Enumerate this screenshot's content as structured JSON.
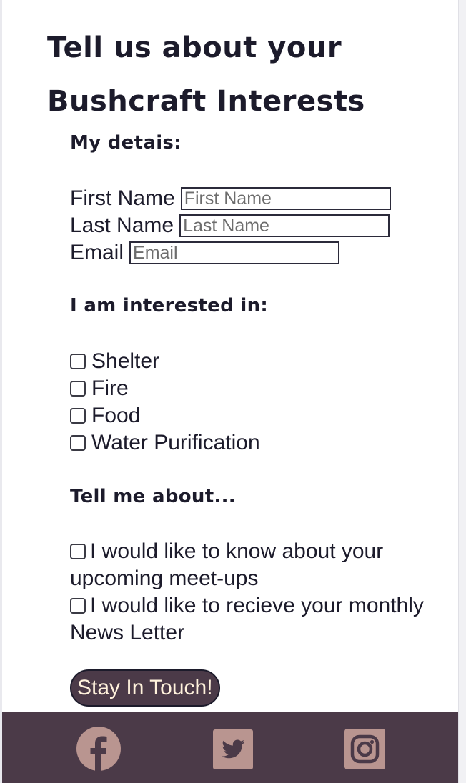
{
  "title": "Tell us about your Bushcraft Interests",
  "details": {
    "heading": "My detais:",
    "first_name": {
      "label": "First Name",
      "placeholder": "First Name",
      "value": ""
    },
    "last_name": {
      "label": "Last Name",
      "placeholder": "Last Name",
      "value": ""
    },
    "email": {
      "label": "Email",
      "placeholder": "Email",
      "value": ""
    }
  },
  "interests": {
    "heading": "I am interested in:",
    "options": [
      {
        "label": "Shelter",
        "checked": false
      },
      {
        "label": "Fire",
        "checked": false
      },
      {
        "label": "Food",
        "checked": false
      },
      {
        "label": "Water Purification",
        "checked": false
      }
    ]
  },
  "tell_me": {
    "heading": "Tell me about...",
    "options": [
      {
        "label": "I would like to know about your upcoming meet-ups",
        "checked": false
      },
      {
        "label": "I would like to recieve your monthly News Letter",
        "checked": false
      }
    ]
  },
  "submit_label": "Stay In Touch!",
  "footer": {
    "icons": [
      "facebook-icon",
      "twitter-icon",
      "instagram-icon"
    ],
    "background": "#4b3a48",
    "icon_color": "#b99590"
  },
  "colors": {
    "text": "#1c1b2b",
    "button_bg": "#4b3a48",
    "button_text": "#fff2dc"
  }
}
